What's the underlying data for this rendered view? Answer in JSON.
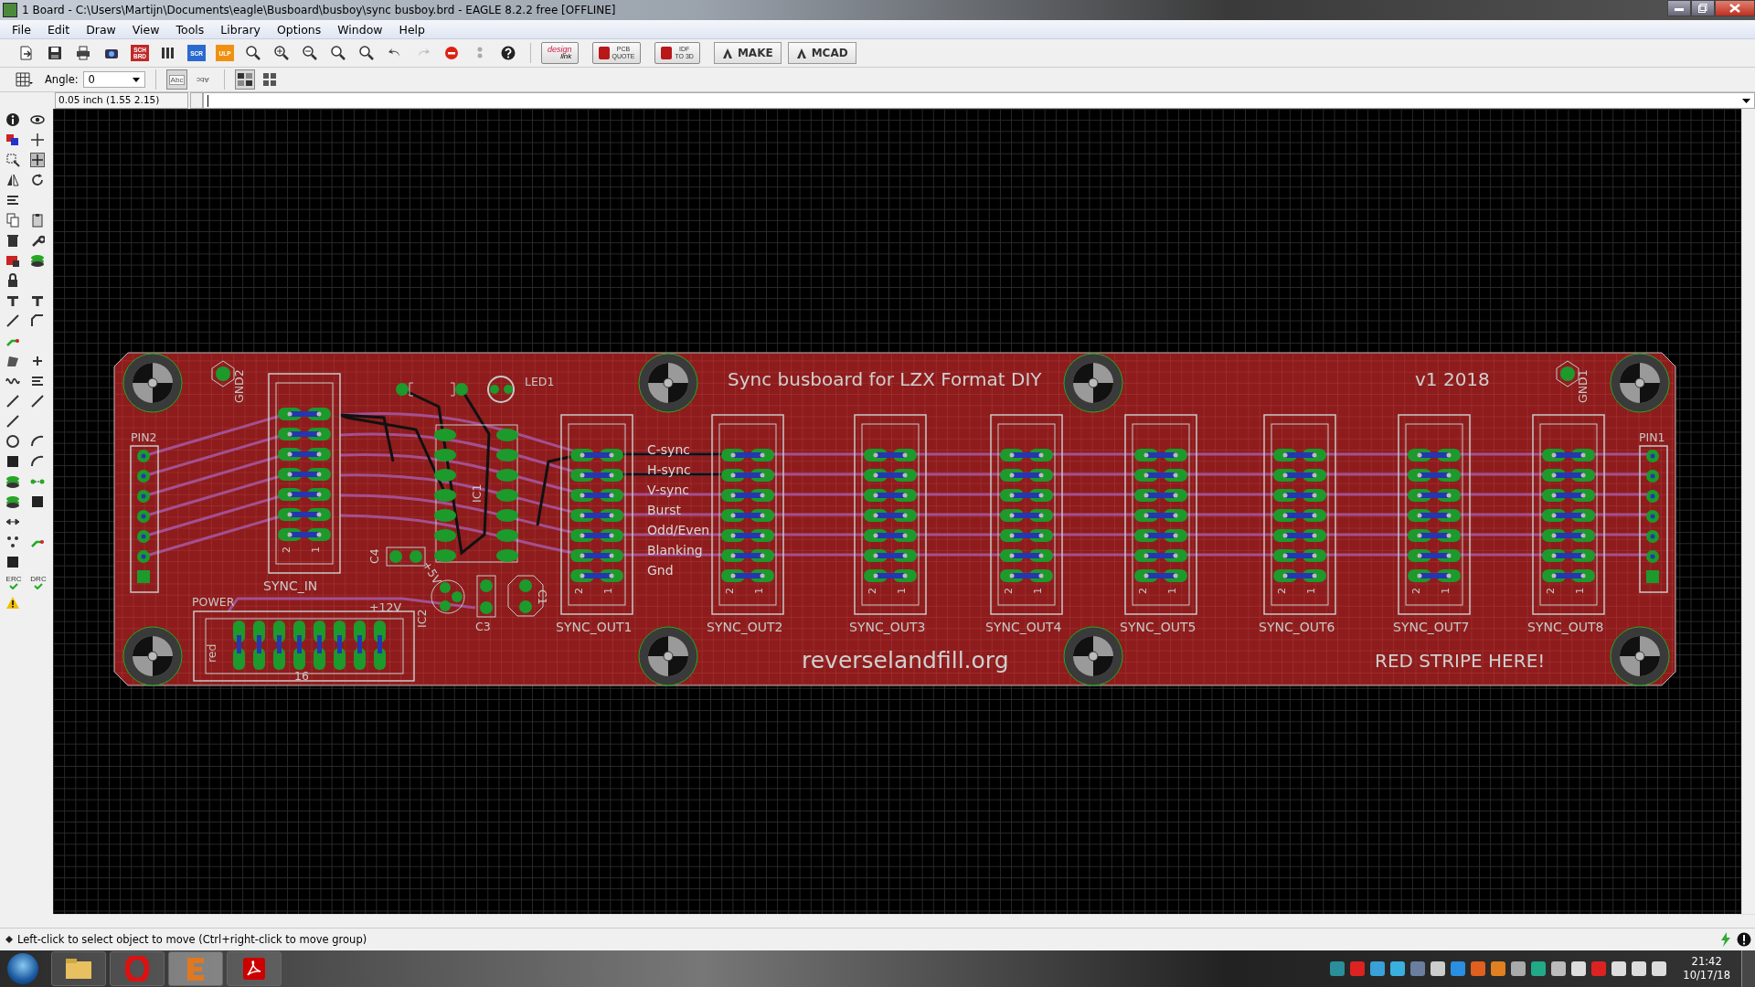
{
  "window": {
    "title": "1 Board - C:\\Users\\Martijn\\Documents\\eagle\\Busboard\\busboy\\sync busboy.brd - EAGLE 8.2.2 free [OFFLINE]"
  },
  "menu": [
    {
      "label": "File"
    },
    {
      "label": "Edit"
    },
    {
      "label": "Draw"
    },
    {
      "label": "View"
    },
    {
      "label": "Tools"
    },
    {
      "label": "Library"
    },
    {
      "label": "Options"
    },
    {
      "label": "Window"
    },
    {
      "label": "Help"
    }
  ],
  "toolbar": {
    "icon_labels": [
      {
        "lines": [
          "SCH",
          "BRD"
        ]
      },
      {
        "lines": [
          "SCR"
        ]
      },
      {
        "lines": [
          "ULP"
        ]
      }
    ],
    "text_buttons": [
      {
        "kind": "badge",
        "lines": [
          "design",
          "link"
        ]
      },
      {
        "kind": "badge",
        "lines": [
          "PCB",
          "QUOTE"
        ]
      },
      {
        "kind": "badge",
        "lines": [
          "IDF",
          "TO 3D"
        ]
      },
      {
        "kind": "brand",
        "lines": [
          "MAKE"
        ]
      },
      {
        "kind": "brand",
        "lines": [
          "MCAD"
        ]
      }
    ]
  },
  "options_bar": {
    "angle_label": "Angle:",
    "angle_value": "0",
    "text_toggles": [
      {
        "label": "Abc",
        "kind": "normal",
        "selected": true
      },
      {
        "label": "Abc",
        "kind": "mirrored",
        "selected": false
      }
    ]
  },
  "command_line": {
    "coordinates": "0.05 inch (1.55 2.15)"
  },
  "left_toolbar": {
    "labels": [
      "ERC",
      "DRC"
    ]
  },
  "board": {
    "title": "Sync busboard for LZX Format DIY",
    "version": "v1 2018",
    "website": "reverselandfill.org",
    "note": "RED STRIPE HERE!",
    "headers": [
      {
        "label": "SYNC_IN",
        "pin_labels": [
          "2",
          "1"
        ]
      },
      {
        "label": "SYNC_OUT1",
        "pin_labels": [
          "2",
          "1"
        ]
      },
      {
        "label": "SYNC_OUT2",
        "pin_labels": [
          "2",
          "1"
        ]
      },
      {
        "label": "SYNC_OUT3",
        "pin_labels": [
          "2",
          "1"
        ]
      },
      {
        "label": "SYNC_OUT4",
        "pin_labels": [
          "2",
          "1"
        ]
      },
      {
        "label": "SYNC_OUT5",
        "pin_labels": [
          "2",
          "1"
        ]
      },
      {
        "label": "SYNC_OUT6",
        "pin_labels": [
          "2",
          "1"
        ]
      },
      {
        "label": "SYNC_OUT7",
        "pin_labels": [
          "2",
          "1"
        ]
      },
      {
        "label": "SYNC_OUT8",
        "pin_labels": [
          "2",
          "1"
        ]
      }
    ],
    "signal_labels": [
      "C-sync",
      "H-sync",
      "V-sync",
      "Burst",
      "Odd/Even",
      "Blanking",
      "Gnd"
    ],
    "part_labels": [
      "PIN2",
      "PIN1",
      "GND2",
      "GND1",
      "POWER",
      "LED1",
      "C4",
      "IC1",
      "IC2",
      "C3",
      "C1",
      "+5V",
      "+12V",
      "red",
      "16"
    ]
  },
  "status_bar": {
    "message": "Left-click to select object to move (Ctrl+right-click to move group)"
  },
  "taskbar": {
    "time": "21:42",
    "date": "10/17/18"
  }
}
